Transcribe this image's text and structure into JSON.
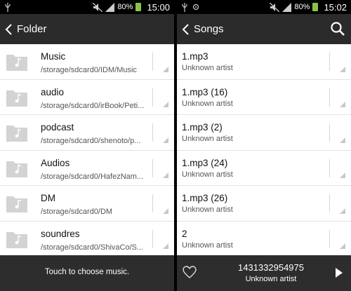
{
  "left": {
    "status": {
      "battery": "80%",
      "time": "15:00"
    },
    "header": {
      "title": "Folder"
    },
    "folders": [
      {
        "name": "Music",
        "path": "/storage/sdcard0/IDM/Music"
      },
      {
        "name": "audio",
        "path": "/storage/sdcard0/irBook/Peti..."
      },
      {
        "name": "podcast",
        "path": "/storage/sdcard0/shenoto/p..."
      },
      {
        "name": "Audios",
        "path": "/storage/sdcard0/HafezNam..."
      },
      {
        "name": "DM",
        "path": "/storage/sdcard0/DM"
      },
      {
        "name": "soundres",
        "path": "/storage/sdcard0/ShivaCo/S..."
      }
    ],
    "footer": {
      "message": "Touch to choose music."
    }
  },
  "right": {
    "status": {
      "battery": "80%",
      "time": "15:02"
    },
    "header": {
      "title": "Songs"
    },
    "songs": [
      {
        "title": "1.mp3",
        "artist": "Unknown artist"
      },
      {
        "title": "1.mp3 (16)",
        "artist": "Unknown artist"
      },
      {
        "title": "1.mp3 (2)",
        "artist": "Unknown artist"
      },
      {
        "title": "1.mp3 (24)",
        "artist": "Unknown artist"
      },
      {
        "title": "1.mp3 (26)",
        "artist": "Unknown artist"
      },
      {
        "title": "2",
        "artist": "Unknown artist"
      }
    ],
    "now_playing": {
      "title": "1431332954975",
      "artist": "Unknown artist"
    }
  },
  "icons": {
    "usb": "usb-icon",
    "mute": "mute-icon",
    "signal": "signal-icon",
    "battery": "battery-icon",
    "back": "chevron-left-icon",
    "search": "search-icon",
    "folder": "folder-icon",
    "heart": "heart-icon",
    "play": "play-icon"
  },
  "colors": {
    "actionbar": "#2b2b2b",
    "footer": "#2d2d2d",
    "battery": "#8bc34a"
  }
}
